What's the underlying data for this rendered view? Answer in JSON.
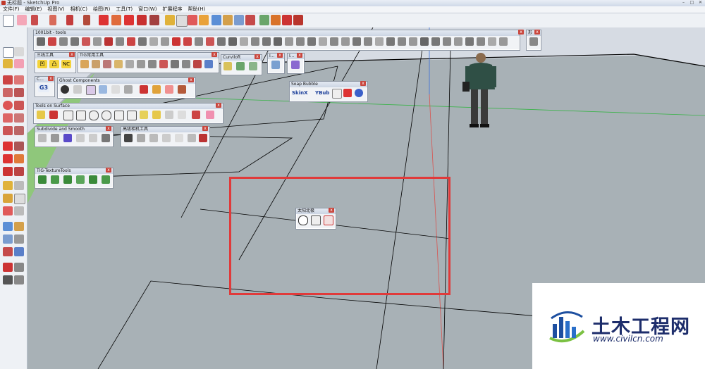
{
  "window": {
    "title": "无标题 - SketchUp Pro"
  },
  "menu": [
    "文件(F)",
    "编辑(E)",
    "视图(V)",
    "相机(C)",
    "绘图(R)",
    "工具(T)",
    "窗口(W)",
    "扩展程序",
    "帮助(H)"
  ],
  "panels": {
    "p1001bit": {
      "title": "1001bit - tools",
      "close": "x"
    },
    "sanxian": {
      "title": "三线工具",
      "close": "x",
      "labels": [
        "凹",
        "凸",
        "NC"
      ]
    },
    "tig": {
      "title": "TIG常用工具",
      "close": "x"
    },
    "curviloft": {
      "title": "Curviloft",
      "close": "x"
    },
    "small1": {
      "title": "I...",
      "close": "x"
    },
    "small2": {
      "title": "I...",
      "close": "x"
    },
    "c_panel": {
      "title": "C...",
      "close": "x",
      "labels": [
        "G3"
      ]
    },
    "ghost": {
      "title": "Ghost Components",
      "close": "x"
    },
    "soap": {
      "title": "Soap Bubble",
      "close": "x",
      "labels": [
        "SkinX",
        "YBub"
      ]
    },
    "tools_surface": {
      "title": "Tools on Surface",
      "close": "x"
    },
    "subdivide": {
      "title": "Subdivide and Smooth",
      "close": "x"
    },
    "camera": {
      "title": "高级相机工具",
      "close": "x"
    },
    "texture": {
      "title": "TIG-TextureTools",
      "close": "x"
    },
    "sun": {
      "title": "太阳北极",
      "close": "x"
    },
    "trays": {
      "title": "形",
      "close": "x"
    }
  },
  "watermark": {
    "name": "土木工程网",
    "url": "www.civilcn.com"
  },
  "colors": {
    "highlight": "#e03a3a",
    "ground": "#a8b1b6",
    "grass": "#8fc77b",
    "sky": "#d6dbe3",
    "green_axis": "#3bb34a",
    "red_axis": "#d9534f",
    "blue_axis": "#3b6fd9"
  }
}
